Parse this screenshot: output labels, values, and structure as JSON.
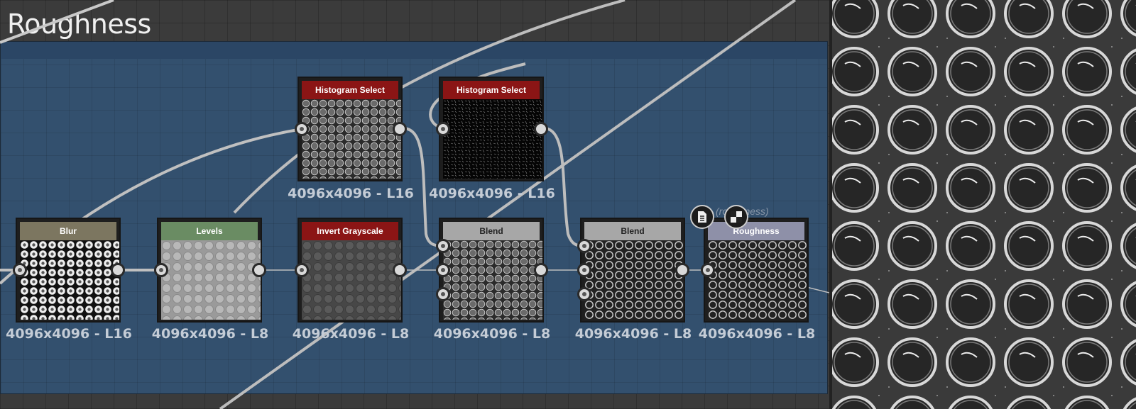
{
  "frame": {
    "title": "Roughness"
  },
  "nodes": {
    "hist1": {
      "title": "Histogram Select",
      "res": "4096x4096 - L16",
      "header_color": "#8b1515"
    },
    "hist2": {
      "title": "Histogram Select",
      "res": "4096x4096 - L16",
      "header_color": "#8b1515"
    },
    "blur": {
      "title": "Blur",
      "res": "4096x4096 - L16",
      "header_color": "#7c7660"
    },
    "levels": {
      "title": "Levels",
      "res": "4096x4096 - L8",
      "header_color": "#6a8c63"
    },
    "invert": {
      "title": "Invert Grayscale",
      "res": "4096x4096 - L8",
      "header_color": "#8b1515"
    },
    "blend1": {
      "title": "Blend",
      "res": "4096x4096 - L8",
      "header_color": "#a7a7a7"
    },
    "blend2": {
      "title": "Blend",
      "res": "4096x4096 - L8",
      "header_color": "#a7a7a7"
    },
    "output": {
      "title": "roughness",
      "res": "4096x4096 - L8",
      "header_color": "#8e90a8",
      "hint": "(roughness)"
    }
  },
  "icons": {
    "output_doc": "document-list-icon",
    "output_toggle": "checker-toggle-icon"
  }
}
